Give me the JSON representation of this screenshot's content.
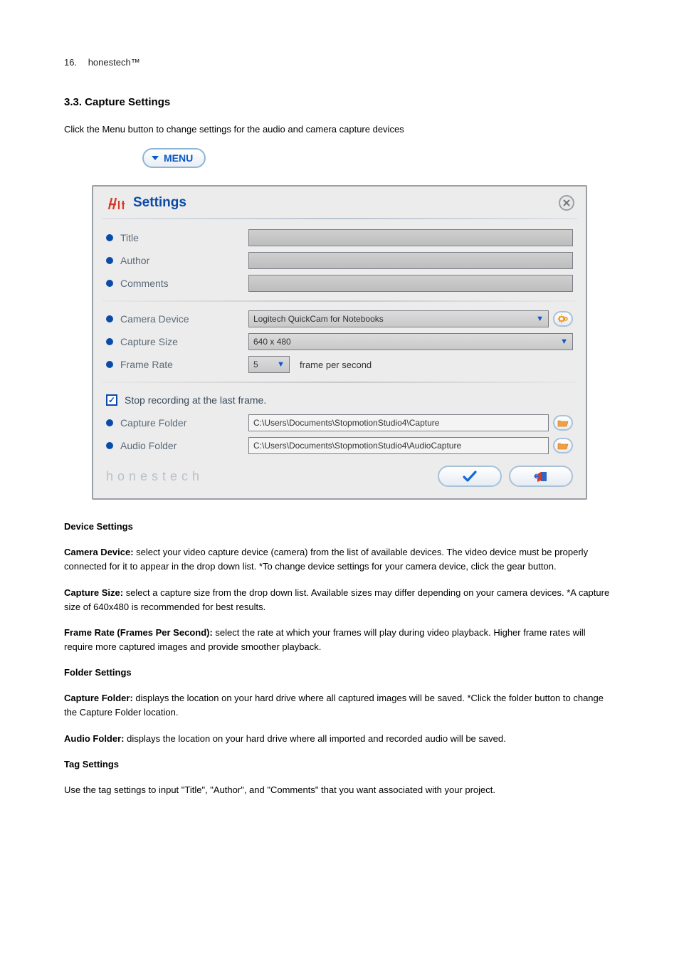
{
  "header": {
    "page": "16.",
    "brand": "honestech™"
  },
  "section3_3": {
    "title": "3.3. Capture Settings",
    "para": "Click the Menu button to change settings for the audio and camera capture devices",
    "menu_button_label": "MENU"
  },
  "dialog": {
    "title": "Settings",
    "rows": {
      "title": {
        "label": "Title",
        "value": ""
      },
      "author": {
        "label": "Author",
        "value": ""
      },
      "comments": {
        "label": "Comments",
        "value": ""
      },
      "camera_device": {
        "label": "Camera Device",
        "selected": "Logitech QuickCam for Notebooks"
      },
      "capture_size": {
        "label": "Capture Size",
        "selected": "640 x 480"
      },
      "frame_rate": {
        "label": "Frame Rate",
        "selected": "5",
        "unit": "frame per second"
      },
      "stop_last_frame": {
        "checked": true,
        "label": "Stop recording at the last frame."
      },
      "capture_folder": {
        "label": "Capture Folder",
        "path": "C:\\Users\\Documents\\StopmotionStudio4\\Capture"
      },
      "audio_folder": {
        "label": "Audio Folder",
        "path": "C:\\Users\\Documents\\StopmotionStudio4\\AudioCapture"
      }
    },
    "footer_brand": "honestech"
  },
  "explain": {
    "device_settings_title": "Device Settings",
    "camera_device_label": "Camera Device:",
    "camera_device_text": " select your video capture device (camera) from the list of available devices. The video device must be properly connected for it to appear in the drop down list. *To change device settings for your camera device, click the gear button.",
    "capture_size_label": "Capture Size:",
    "capture_size_text": " select a capture size from the drop down list. Available sizes may differ depending on your camera devices. *A capture size of 640x480 is recommended for best results.",
    "frame_rate_label": "Frame Rate (Frames Per Second):",
    "frame_rate_text": " select the rate at which your frames will play during video playback. Higher frame rates will require more captured images and provide smoother playback.",
    "folder_settings_title": "Folder Settings",
    "capture_folder_label": "Capture Folder:",
    "capture_folder_text": " displays the location on your hard drive where all captured images will be saved.  *Click the folder button to change the Capture Folder location.",
    "audio_folder_label": "Audio Folder:",
    "audio_folder_text": " displays the location on your hard drive where all imported and recorded audio will be saved.",
    "tag_settings_title": "Tag Settings",
    "tag_settings_text": "Use the tag settings to input \"Title\", \"Author\", and \"Comments\" that you want associated with your project."
  }
}
